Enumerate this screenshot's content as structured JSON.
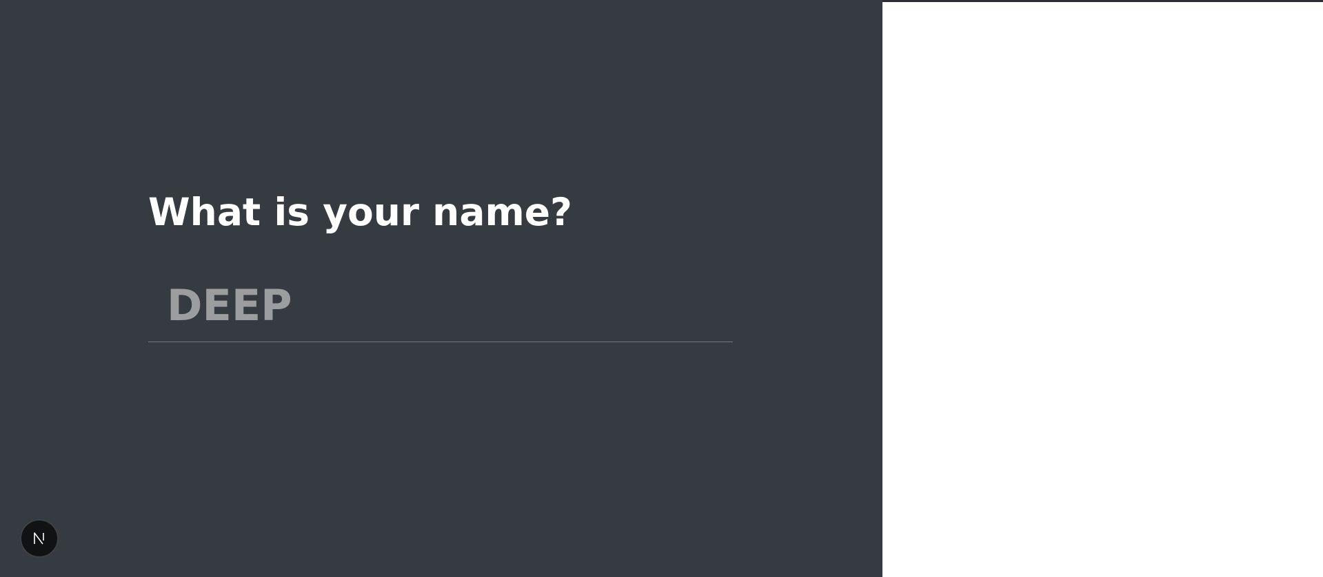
{
  "form": {
    "question": "What is your name?",
    "name_value": "DEEP"
  },
  "badge": {
    "icon": "n-logo-icon"
  },
  "colors": {
    "panel_bg": "#363a41",
    "text_primary": "#ffffff",
    "input_text": "#9c9d9f",
    "underline": "#767a80",
    "right_bg": "#ffffff"
  }
}
